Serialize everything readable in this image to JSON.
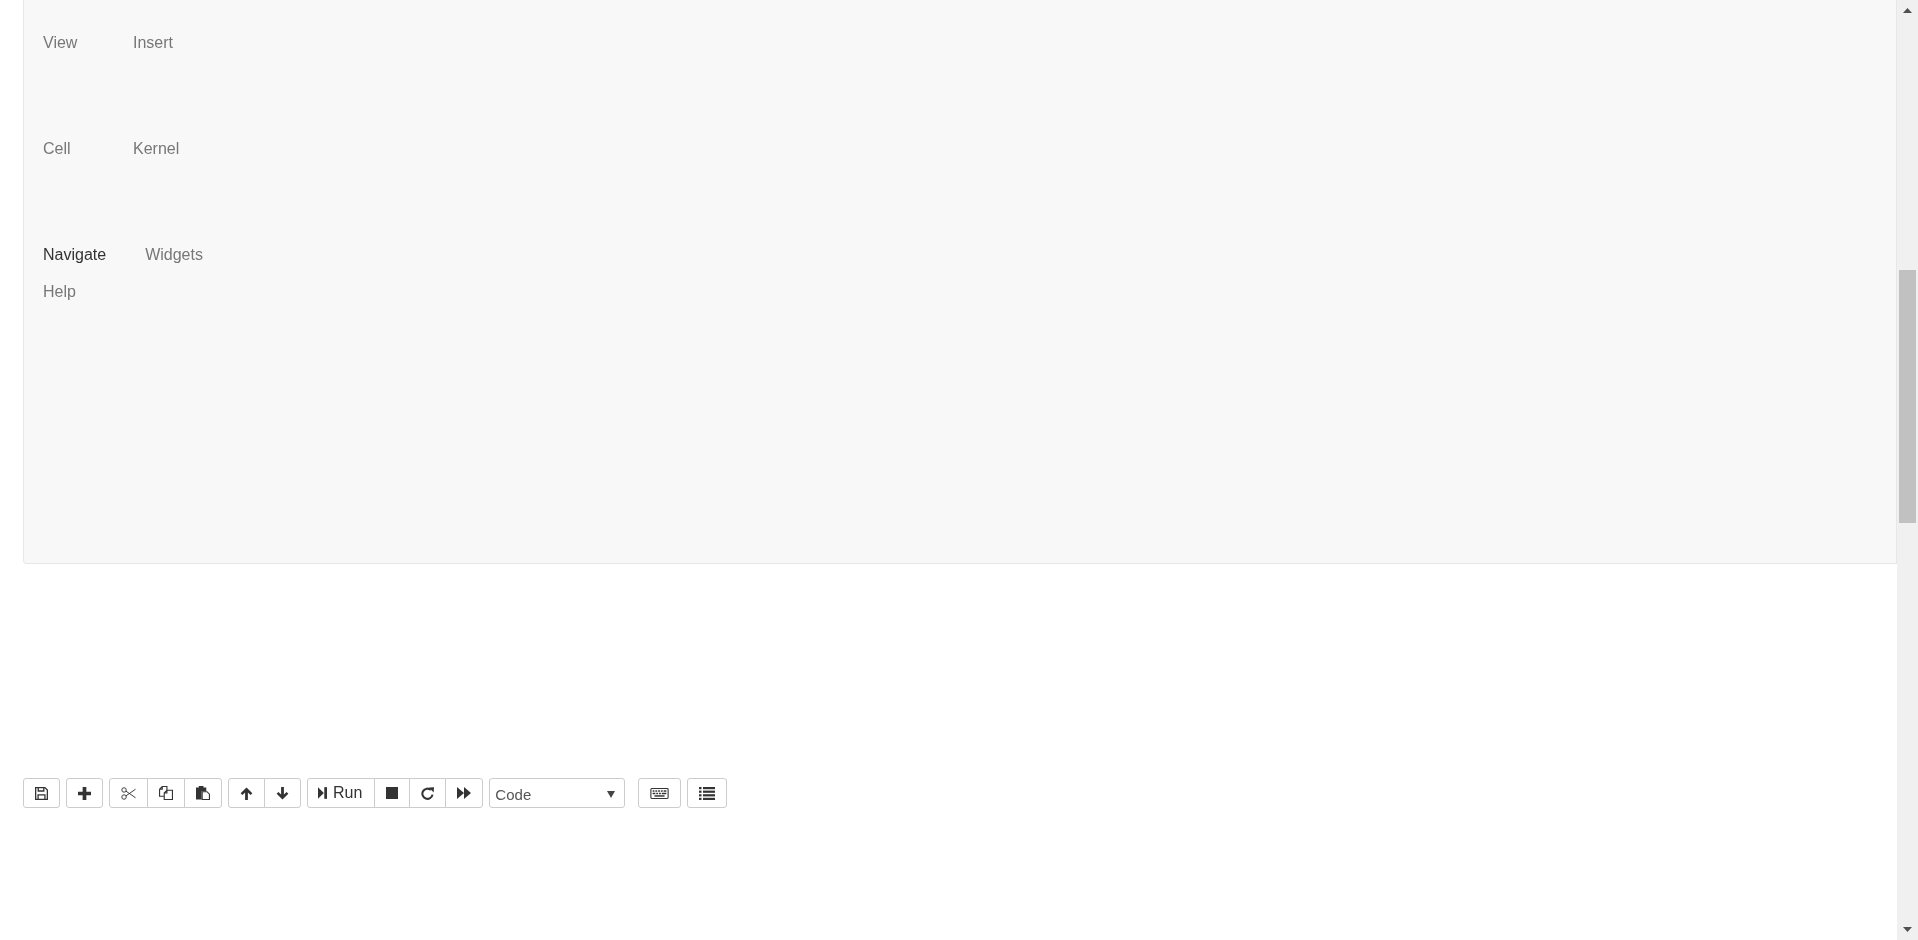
{
  "menu": [
    {
      "items": [
        {
          "label": "View",
          "selected": false
        },
        {
          "label": "Insert",
          "selected": false
        }
      ]
    },
    {
      "items": [
        {
          "label": "Cell",
          "selected": false
        },
        {
          "label": "Kernel",
          "selected": false
        }
      ]
    },
    {
      "items": [
        {
          "label": "Navigate",
          "selected": true
        },
        {
          "label": "Widgets",
          "selected": false
        }
      ]
    },
    {
      "items": [
        {
          "label": "Help",
          "selected": false
        }
      ]
    }
  ],
  "toolbar": {
    "run_label": "Run",
    "cell_type": "Code"
  }
}
